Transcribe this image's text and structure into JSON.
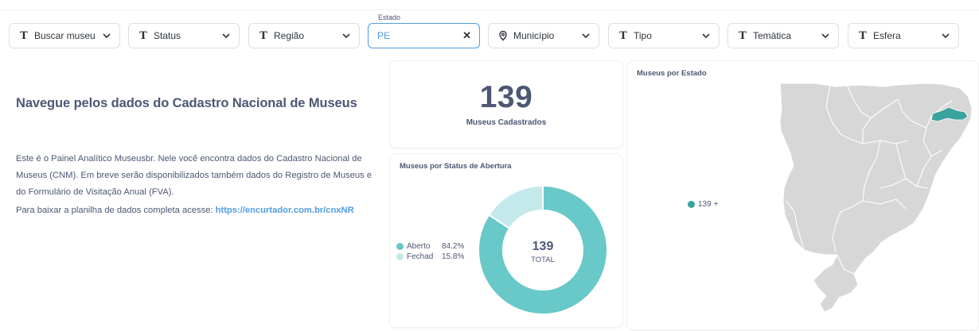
{
  "filters": {
    "active_label": "Estado",
    "items": [
      {
        "label": "Buscar museu",
        "icon": "text-type-icon"
      },
      {
        "label": "Status",
        "icon": "text-type-icon"
      },
      {
        "label": "Região",
        "icon": "text-type-icon"
      },
      {
        "label": "PE",
        "icon": "none",
        "active": true
      },
      {
        "label": "Município",
        "icon": "location-pin-icon"
      },
      {
        "label": "Tipo",
        "icon": "text-type-icon"
      },
      {
        "label": "Temática",
        "icon": "text-type-icon"
      },
      {
        "label": "Esfera",
        "icon": "text-type-icon"
      }
    ]
  },
  "intro": {
    "title": "Navegue pelos dados do Cadastro Nacional de Museus",
    "paragraph1": "Este é o Painel Analítico Museusbr. Nele você encontra dados do Cadastro Nacional de Museus (CNM). Em breve serão disponibilizados também dados do Registro de Museus e do Formulário de Visitação Anual (FVA).",
    "paragraph2_prefix": "Para baixar a planilha de dados completa acesse: ",
    "paragraph2_link": "https://encurtador.com.br/cnxNR"
  },
  "kpi": {
    "value": "139",
    "caption": "Museus Cadastrados"
  },
  "donut_card": {
    "title": "Museus por Status de Abertura",
    "total_value": "139",
    "total_label": "TOTAL",
    "legend": [
      {
        "name": "Aberto",
        "pct": "84.2%",
        "color": "#69c8c8"
      },
      {
        "name": "Fechad",
        "pct": "15.8%",
        "color": "#c4e9ea"
      }
    ]
  },
  "map_card": {
    "title": "Museus por Estado",
    "legend_label": "139 +",
    "legend_color": "#3aa39e",
    "base_color": "#d7d7d7",
    "highlight_state": "PE"
  },
  "chart_data": {
    "type": "pie",
    "categories": [
      "Aberto",
      "Fechad"
    ],
    "values": [
      84.2,
      15.8
    ],
    "title": "Museus por Status de Abertura"
  },
  "colors": {
    "accent": "#509ee3",
    "text": "#4c5773",
    "teal": "#69c8c8",
    "light_teal": "#c4e9ea"
  }
}
